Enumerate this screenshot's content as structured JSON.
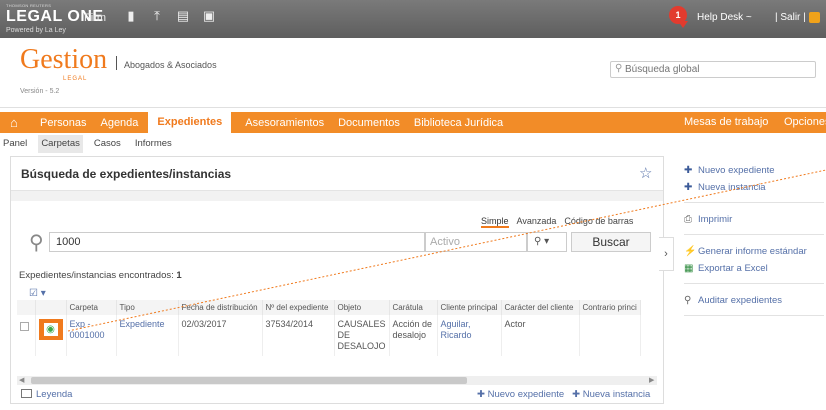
{
  "topbar": {
    "brand_small": "THOMSON REUTERS",
    "brand": "LEGAL ONE",
    "powered": "Powered by La Ley",
    "firm": "Firm",
    "notif_count": "1",
    "helpdesk": "Help Desk ~",
    "salir": "| Salir |",
    "icons": [
      "books-icon",
      "chart-icon",
      "document-icon",
      "image-icon"
    ]
  },
  "header": {
    "logo": "Gestion",
    "logo_sub": "LEGAL",
    "version": "Versión - 5.2",
    "firm_name": "Abogados & Asociados",
    "search_placeholder": "Búsqueda global"
  },
  "nav": {
    "items": [
      "Personas",
      "Agenda",
      "Expedientes",
      "Asesoramientos",
      "Documentos",
      "Biblioteca Jurídica"
    ],
    "active": "Expedientes",
    "right": [
      "Mesas de trabajo",
      "Opciones"
    ]
  },
  "subnav": [
    "Panel",
    "Carpetas",
    "Casos",
    "Informes"
  ],
  "panel": {
    "title": "Búsqueda de expedientes/instancias",
    "tabs": [
      "Simple",
      "Avanzada",
      "Código de barras"
    ],
    "query": "1000",
    "estado": "Activo",
    "buscar": "Buscar",
    "found_label": "Expedientes/instancias encontrados:",
    "found_count": "1",
    "columns": [
      "Carpeta",
      "Tipo",
      "Fecha de distribución",
      "Nº del expediente",
      "Objeto",
      "Carátula",
      "Cliente principal",
      "Carácter del cliente",
      "Contrario princi"
    ],
    "rows": [
      {
        "carpeta": "Exp - 0001000",
        "tipo": "Expediente",
        "fecha": "02/03/2017",
        "numero": "37534/2014",
        "objeto": "CAUSALES DE DESALOJO",
        "caratula": "Acción de desalojo",
        "cliente": "Aguilar, Ricardo",
        "caracter": "Actor",
        "contrario": ""
      }
    ],
    "leyenda": "Leyenda",
    "bottom_new_exp": "Nuevo expediente",
    "bottom_new_inst": "Nueva instancia"
  },
  "side": {
    "group1": [
      "Nuevo expediente",
      "Nueva instancia"
    ],
    "group2": [
      "Imprimir"
    ],
    "group3": [
      "Generar informe estándar",
      "Exportar a Excel"
    ],
    "group4": [
      "Auditar expedientes"
    ]
  },
  "colors": {
    "accent": "#f28c28",
    "link": "#5570a8",
    "topbar": "#6a6a6a"
  }
}
